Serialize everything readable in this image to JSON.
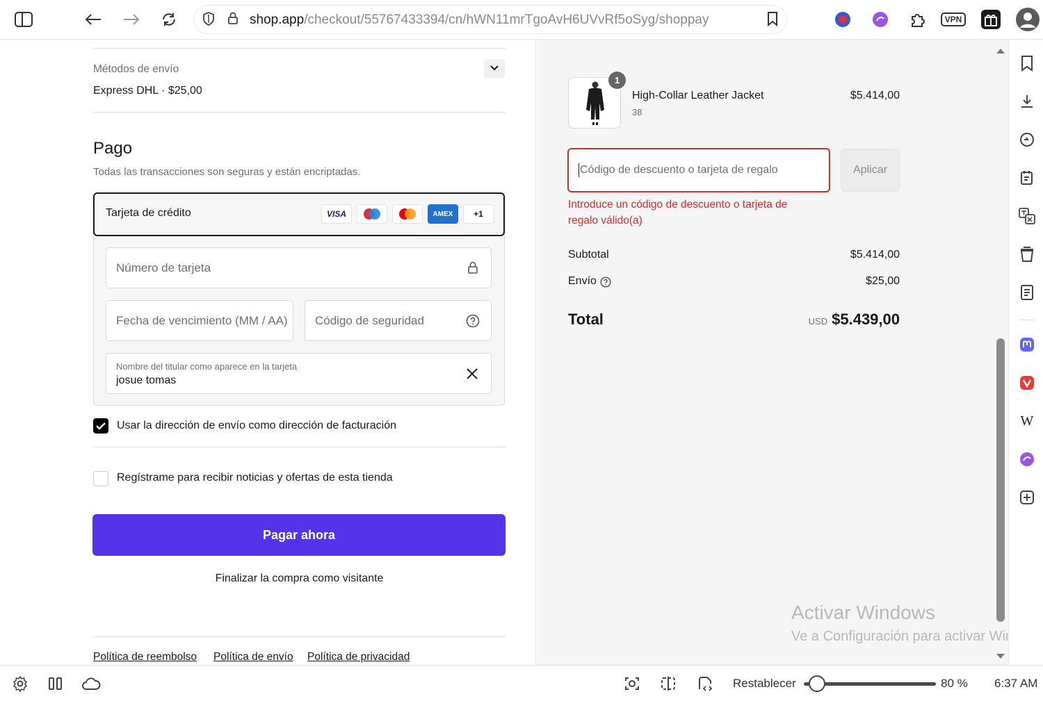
{
  "browser": {
    "url_host": "shop.app",
    "url_path": "/checkout/55767433394/cn/hWN11mrTgoAvH6UVvRf5oSyg/shoppay",
    "vpn_label": "VPN"
  },
  "shipping": {
    "section_label": "Métodos de envío",
    "selected_method": "Express DHL · $25,00"
  },
  "payment": {
    "title": "Pago",
    "subtitle": "Todas las transacciones son seguras y están encriptadas.",
    "method_label": "Tarjeta de crédito",
    "card_logos": [
      "VISA",
      "maestro",
      "mastercard",
      "AMEX",
      "+1"
    ],
    "card_number_placeholder": "Número de tarjeta",
    "expiry_placeholder": "Fecha de vencimiento (MM / AA)",
    "cvv_placeholder": "Código de seguridad",
    "holder_label": "Nombre del titular como aparece en la tarjeta",
    "holder_value": "josue tomas"
  },
  "options": {
    "billing_same": "Usar la dirección de envío como dirección de facturación",
    "billing_same_checked": true,
    "newsletter": "Regístrame para recibir noticias y ofertas de esta tienda",
    "newsletter_checked": false
  },
  "actions": {
    "pay_now": "Pagar ahora",
    "guest_checkout": "Finalizar la compra como visitante"
  },
  "footer_links": [
    "Política de reembolso",
    "Política de envío",
    "Política de privacidad"
  ],
  "order": {
    "item": {
      "name": "High-Collar Leather Jacket",
      "variant": "38",
      "quantity": "1",
      "price": "$5.414,00"
    },
    "discount_placeholder": "Código de descuento o tarjeta de regalo",
    "apply_label": "Aplicar",
    "discount_error": "Introduce un código de descuento o tarjeta de regalo válido(a)",
    "subtotal_label": "Subtotal",
    "subtotal_value": "$5.414,00",
    "shipping_label": "Envío",
    "shipping_value": "$25,00",
    "total_label": "Total",
    "total_currency": "USD",
    "total_value": "$5.439,00"
  },
  "watermark": {
    "line1": "Activar Windows",
    "line2": "Ve a Configuración para activar Windows."
  },
  "statusbar": {
    "reset_label": "Restablecer",
    "zoom": "80 %",
    "zoom_fraction": 0.1,
    "time": "6:37 AM"
  },
  "colors": {
    "accent": "#5433eb",
    "error": "#d42c2c",
    "checkbox": "#000000"
  }
}
